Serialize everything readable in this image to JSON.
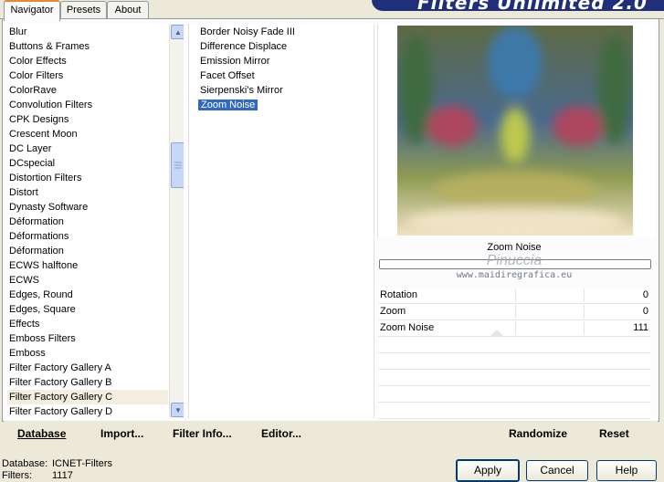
{
  "tabs": [
    {
      "label": "Navigator",
      "active": true
    },
    {
      "label": "Presets",
      "active": false
    },
    {
      "label": "About",
      "active": false
    }
  ],
  "banner_title": "Filters Unlimited 2.0",
  "categories": [
    "Blur",
    "Buttons & Frames",
    "Color Effects",
    "Color Filters",
    "ColorRave",
    "Convolution Filters",
    "CPK Designs",
    "Crescent Moon",
    "DC Layer",
    "DCspecial",
    "Distortion Filters",
    "Distort",
    "Dynasty Software",
    "Déformation",
    "Déformations",
    "Déformation",
    "ECWS halftone",
    "ECWS",
    "Edges, Round",
    "Edges, Square",
    "Effects",
    "Emboss Filters",
    "Emboss",
    "Filter Factory Gallery A",
    "Filter Factory Gallery B",
    "Filter Factory Gallery C",
    "Filter Factory Gallery D"
  ],
  "selected_category": "Filter Factory Gallery C",
  "filters": [
    "Border Noisy Fade III",
    "Difference Displace",
    "Emission Mirror",
    "Facet Offset",
    "Sierpenski's Mirror",
    "Zoom Noise"
  ],
  "selected_filter": "Zoom Noise",
  "preview": {
    "filter_name": "Zoom Noise",
    "watermark_name": "Pinuccia",
    "watermark_url": "www.maidiregrafica.eu"
  },
  "parameters": [
    {
      "label": "Rotation",
      "value": "0"
    },
    {
      "label": "Zoom",
      "value": "0"
    },
    {
      "label": "Zoom Noise",
      "value": "111"
    }
  ],
  "bottom_bar": {
    "database": "Database",
    "import": "Import...",
    "filter_info": "Filter Info...",
    "editor": "Editor...",
    "randomize": "Randomize",
    "reset": "Reset"
  },
  "status": {
    "database_label": "Database:",
    "database_value": "ICNET-Filters",
    "filters_label": "Filters:",
    "filters_value": "1117"
  },
  "buttons": {
    "apply": "Apply",
    "cancel": "Cancel",
    "help": "Help"
  }
}
